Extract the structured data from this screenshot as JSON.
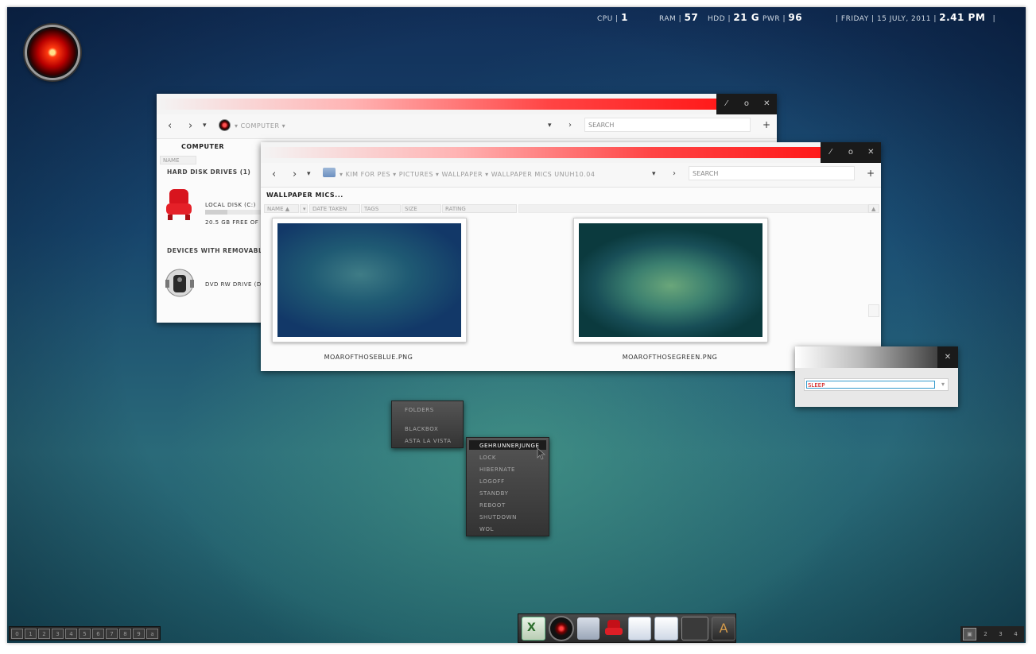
{
  "stats": {
    "cpu_label": "CPU |",
    "cpu_value": "1",
    "ram_label": "RAM |",
    "ram_value": "57",
    "hdd_label": "HDD |",
    "hdd_value": "21 G",
    "pwr_label": "PWR |",
    "pwr_value": "96",
    "date": "| FRIDAY | 15 JULY, 2011 |",
    "time": "2.41 PM",
    "end": "|"
  },
  "win_computer": {
    "controls": [
      "⁄",
      "o",
      "✕"
    ],
    "crumb": "COMPUTER",
    "search_placeholder": "SEARCH",
    "title": "COMPUTER",
    "column": "NAME",
    "section_hdd": "HARD DISK DRIVES (1)",
    "drive_c_name": "LOCAL DISK (C:)",
    "drive_c_free": "20.5 GB FREE OF",
    "drive_c_used_fraction": 0.4,
    "section_removable": "DEVICES WITH REMOVABLE",
    "drive_d_name": "DVD RW DRIVE (D:)"
  },
  "win_wallpaper": {
    "controls": [
      "⁄",
      "o",
      "✕"
    ],
    "breadcrumb": [
      "KIM FOR PES",
      "PICTURES",
      "WALLPAPER",
      "WALLPAPER MICS UNUH10.04"
    ],
    "search_placeholder": "SEARCH",
    "title": "WALLPAPER MICS...",
    "columns": [
      "NAME",
      "DATE TAKEN",
      "TAGS",
      "SIZE",
      "RATING"
    ],
    "files": [
      "MOAROFTHOSEBLUE.PNG",
      "MOAROFTHOSEGREEN.PNG"
    ]
  },
  "shutdown_dialog": {
    "close": "✕",
    "selected_option": "SLEEP"
  },
  "menu_folders": {
    "items": [
      "FOLDERS",
      "BLACKBOX",
      "ASTA LA VISTA"
    ]
  },
  "menu_session": {
    "items": [
      "GEHRUNNERJUNGE",
      "LOCK",
      "HIBERNATE",
      "LOGOFF",
      "STANDBY",
      "REBOOT",
      "SHUTDOWN",
      "WOL"
    ]
  },
  "workspaces": [
    "0",
    "1",
    "2",
    "3",
    "4",
    "5",
    "6",
    "7",
    "8",
    "9",
    "a"
  ],
  "desks": [
    "",
    "2",
    "3",
    "4"
  ],
  "dock": {
    "icons": [
      "excel-icon",
      "hal-icon",
      "folder-icon",
      "chair-icon",
      "notepad-icon",
      "notepad-icon",
      "blank-icon",
      "font-icon"
    ],
    "font_letter": "A"
  }
}
